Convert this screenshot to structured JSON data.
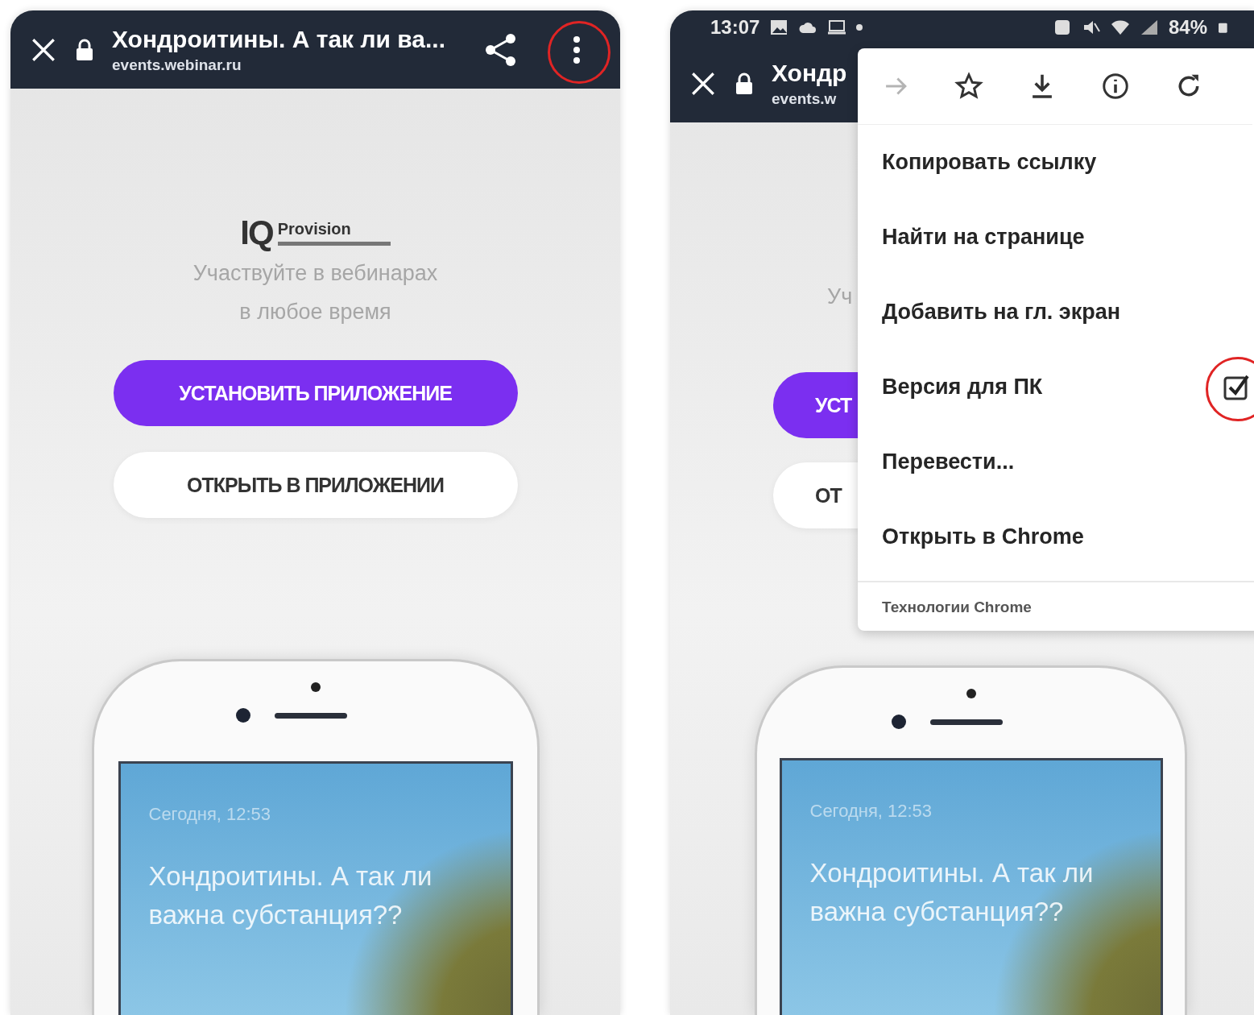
{
  "panels": [
    {
      "header": {
        "title": "Хондроитины. А так ли ва...",
        "url": "events.webinar.ru",
        "menu_button": {
          "highlighted": true
        }
      },
      "page": {
        "logo": {
          "mark": "IQ",
          "name": "Provision"
        },
        "tagline": [
          "Участвуйте в вебинарах",
          "в любое время"
        ],
        "buttons": [
          {
            "label": "УСТАНОВИТЬ ПРИЛОЖЕНИЕ",
            "kind": "primary"
          },
          {
            "label": "ОТКРЫТЬ В ПРИЛОЖЕНИИ",
            "kind": "secondary"
          }
        ]
      },
      "mockup": {
        "date": "Сегодня, 12:53",
        "title": "Хондроитины. А так ли важна субстанция??"
      }
    },
    {
      "status_bar": {
        "time": "13:07",
        "battery": "84%"
      },
      "header": {
        "title": "Хондр",
        "url": "events.w"
      },
      "page": {
        "tagline": [
          "Уч"
        ],
        "buttons": [
          {
            "label": "УСТ",
            "kind": "primary"
          },
          {
            "label": "ОТ",
            "kind": "secondary"
          }
        ]
      },
      "mockup": {
        "date": "Сегодня, 12:53",
        "title": "Хондроитины. А так ли важна субстанция??"
      },
      "menu": {
        "toolbar": [
          {
            "kind": "forward",
            "disabled": true
          },
          {
            "kind": "bookmark",
            "disabled": false
          },
          {
            "kind": "download",
            "disabled": false
          },
          {
            "kind": "info",
            "disabled": false
          },
          {
            "kind": "refresh",
            "disabled": false
          }
        ],
        "items": [
          {
            "label": "Копировать ссылку",
            "kind": "plain"
          },
          {
            "label": "Найти на странице",
            "kind": "plain"
          },
          {
            "label": "Добавить на гл. экран",
            "kind": "plain"
          },
          {
            "label": "Версия для ПК",
            "kind": "checkbox",
            "checked": true,
            "highlighted": true
          },
          {
            "label": "Перевести...",
            "kind": "plain"
          },
          {
            "label": "Открыть в Chrome",
            "kind": "plain"
          }
        ],
        "footer": "Технологии Chrome"
      }
    }
  ]
}
